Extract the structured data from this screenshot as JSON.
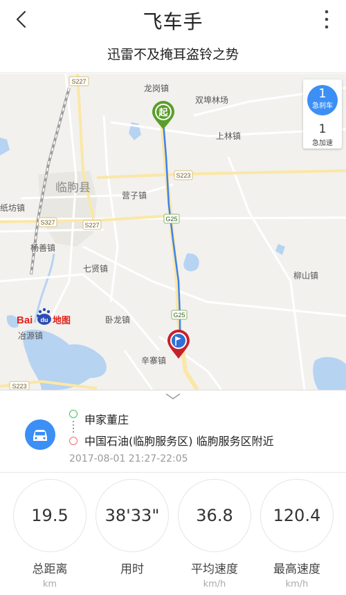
{
  "header": {
    "title": "飞车手",
    "subtitle": "迅雷不及掩耳盗铃之势"
  },
  "map": {
    "labels": {
      "s227_top": "S227",
      "longgang": "龙岗镇",
      "shuangfu": "双埠林场",
      "shanglin": "上林镇",
      "s223": "S223",
      "linqu": "临朐县",
      "yingzi": "营子镇",
      "zhifang": "纸坊镇",
      "s327": "S327",
      "s227_mid": "S227",
      "g25_top": "G25",
      "yangshan": "杨善镇",
      "qixian": "七贤镇",
      "liushan": "柳山镇",
      "g25_bottom": "G25",
      "wolong": "卧龙镇",
      "yeyuan": "冶源镇",
      "xinzhai": "辛寨镇",
      "s223_bottom": "S223",
      "start_marker": "起",
      "baidu_text": "Bai",
      "baidu_du": "du",
      "baidu_map": "地图"
    },
    "stats": {
      "brake_count": "1",
      "brake_label": "急刹车",
      "accel_count": "1",
      "accel_label": "急加速"
    }
  },
  "trip": {
    "start": "申家董庄",
    "end": "中国石油(临朐服务区) 临朐服务区附近",
    "time_range": "2017-08-01 21:27-22:05"
  },
  "metrics": [
    {
      "value": "19.5",
      "label": "总距离",
      "unit": "km"
    },
    {
      "value": "38'33\"",
      "label": "用时",
      "unit": ""
    },
    {
      "value": "36.8",
      "label": "平均速度",
      "unit": "km/h"
    },
    {
      "value": "120.4",
      "label": "最高速度",
      "unit": "km/h"
    }
  ],
  "colors": {
    "accent": "#3b8ff5",
    "route": "#3b82f0",
    "start": "#5a9e2a",
    "end": "#c8202a"
  }
}
